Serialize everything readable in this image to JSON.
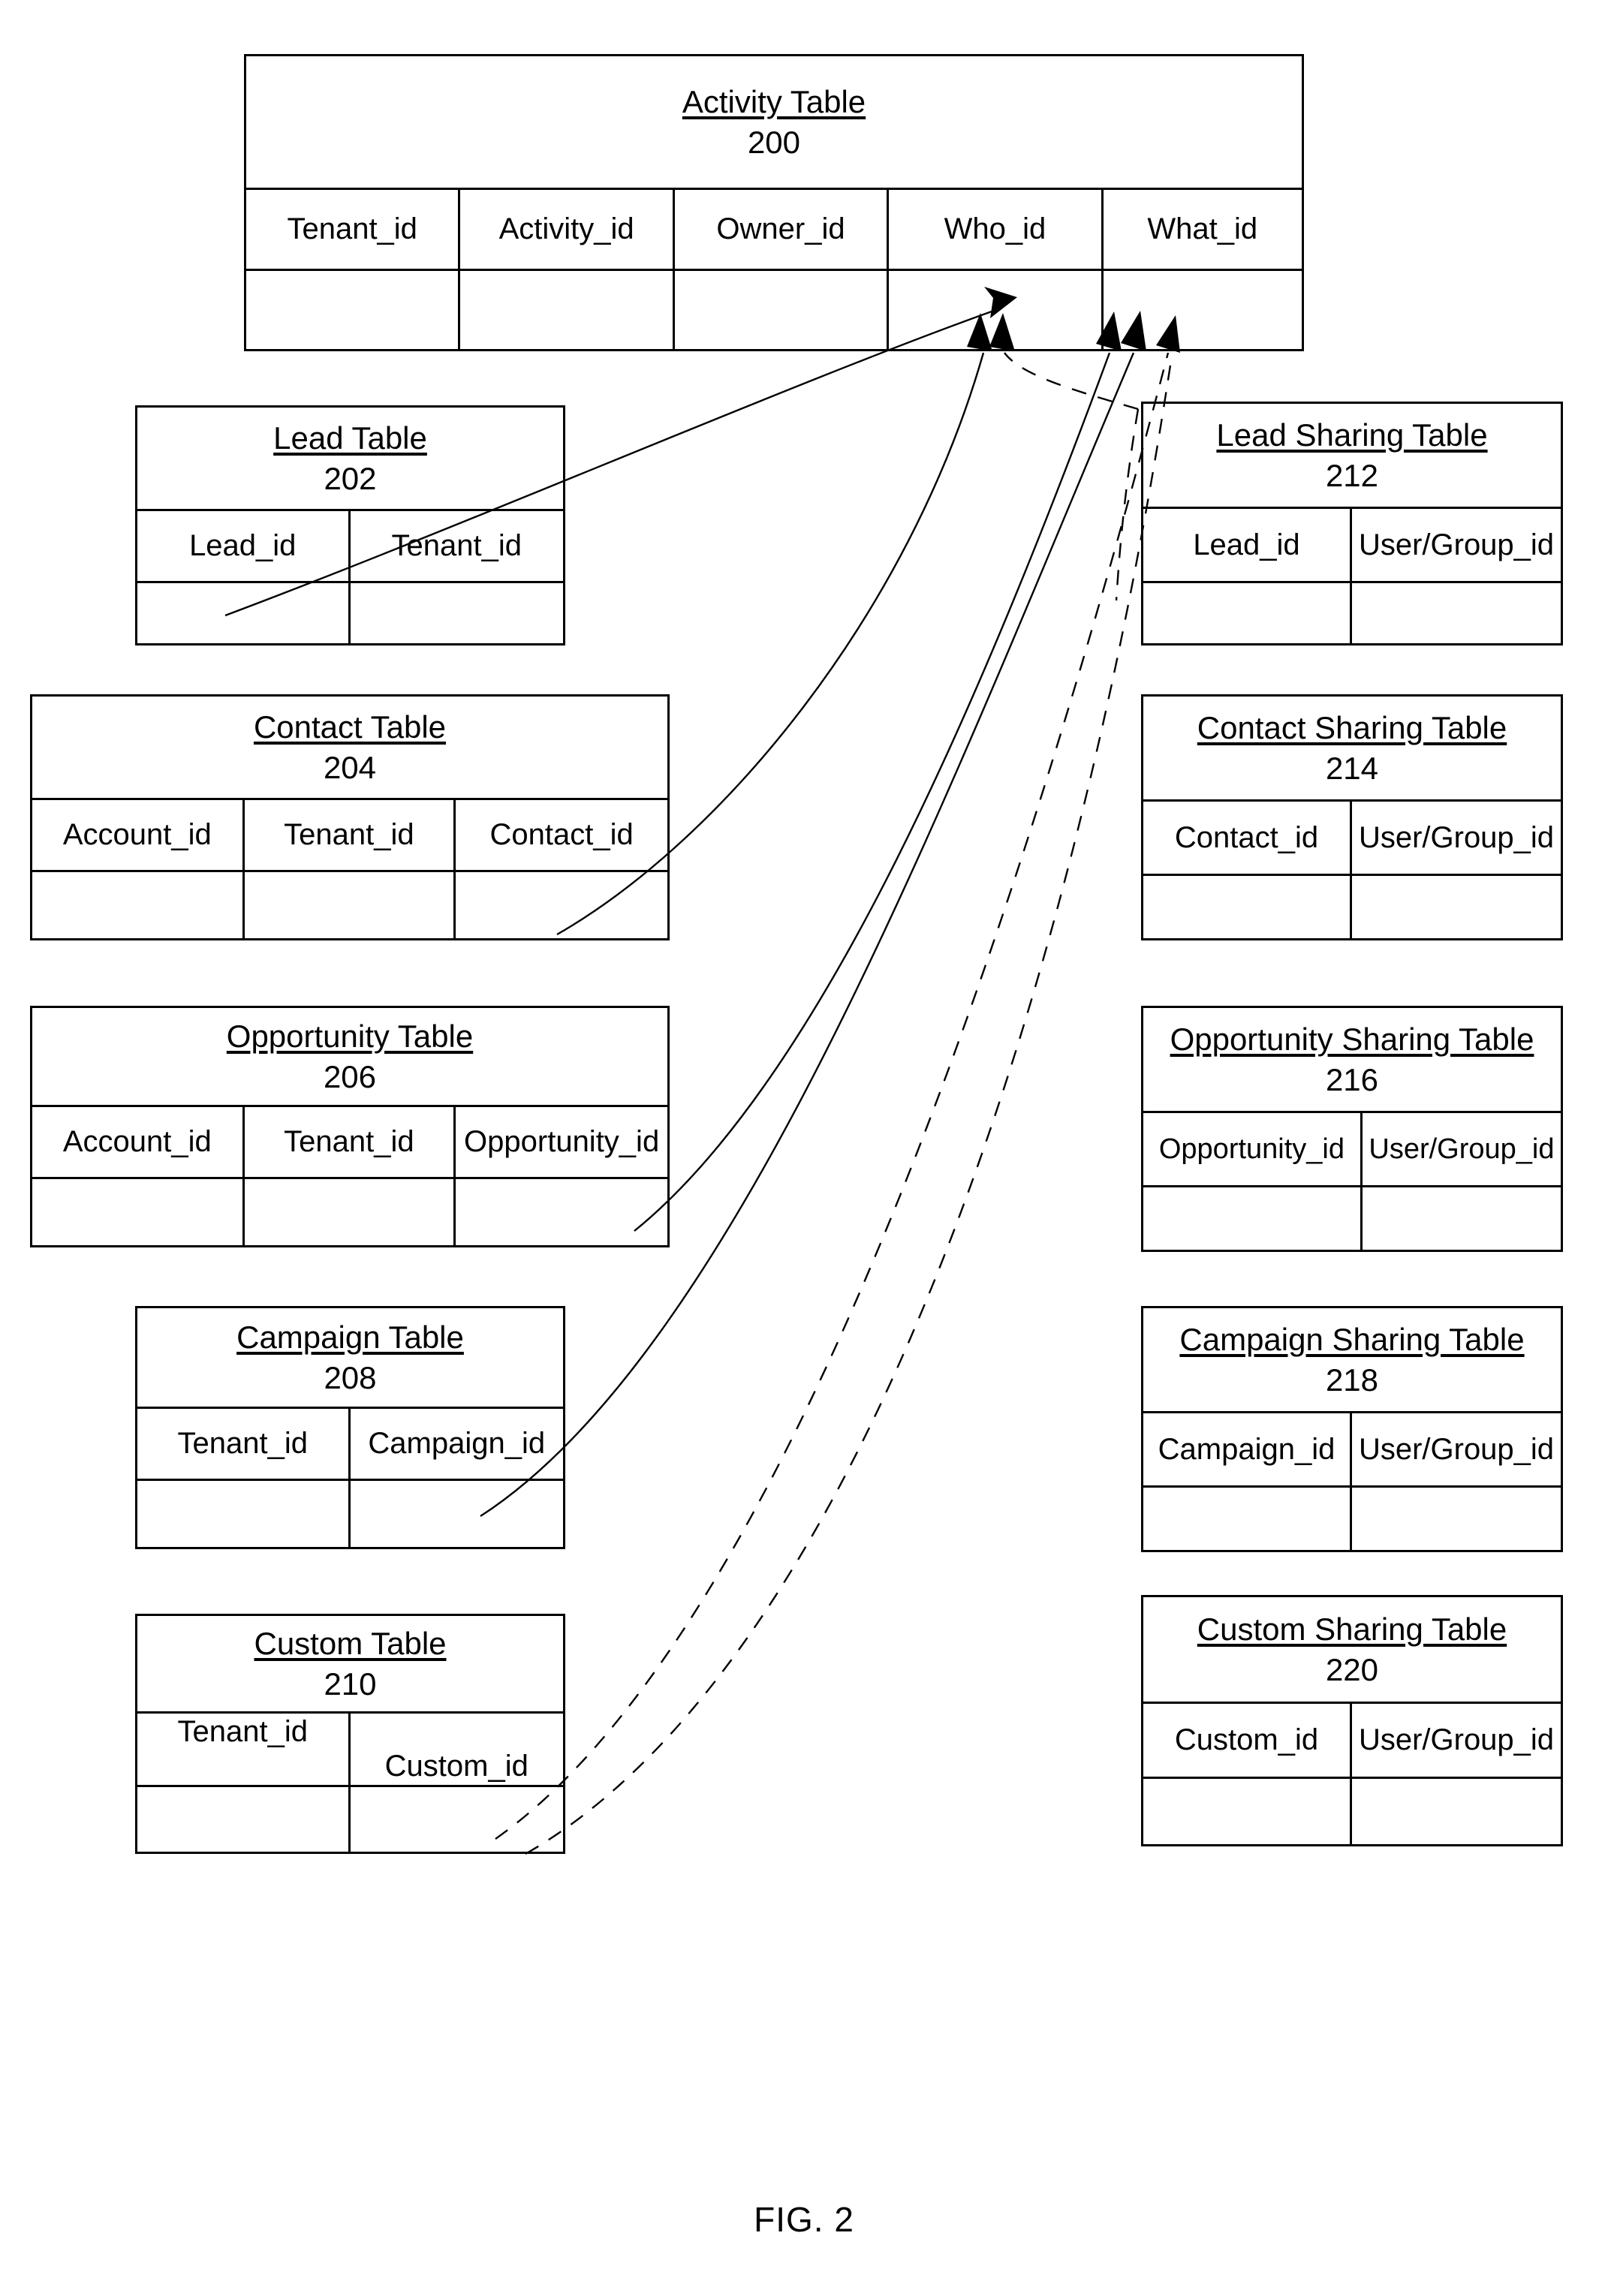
{
  "figure": {
    "caption": "FIG. 2"
  },
  "tables": {
    "activity": {
      "title": "Activity Table",
      "ref": "200",
      "columns": [
        "Tenant_id",
        "Activity_id",
        "Owner_id",
        "Who_id",
        "What_id"
      ]
    },
    "lead": {
      "title": "Lead Table",
      "ref": "202",
      "columns": [
        "Lead_id",
        "Tenant_id"
      ]
    },
    "contact": {
      "title": "Contact Table",
      "ref": "204",
      "columns": [
        "Account_id",
        "Tenant_id",
        "Contact_id"
      ]
    },
    "opportunity": {
      "title": "Opportunity Table",
      "ref": "206",
      "columns": [
        "Account_id",
        "Tenant_id",
        "Opportunity_id"
      ]
    },
    "campaign": {
      "title": "Campaign Table",
      "ref": "208",
      "columns": [
        "Tenant_id",
        "Campaign_id"
      ]
    },
    "custom": {
      "title": "Custom Table",
      "ref": "210",
      "columns": [
        "Tenant_id",
        "Custom_id"
      ]
    },
    "lead_sharing": {
      "title": "Lead Sharing Table",
      "ref": "212",
      "columns": [
        "Lead_id",
        "User/Group_id"
      ]
    },
    "contact_sharing": {
      "title": "Contact Sharing Table",
      "ref": "214",
      "columns": [
        "Contact_id",
        "User/Group_id"
      ]
    },
    "opportunity_sharing": {
      "title": "Opportunity Sharing Table",
      "ref": "216",
      "columns": [
        "Opportunity_id",
        "User/Group_id"
      ]
    },
    "campaign_sharing": {
      "title": "Campaign Sharing Table",
      "ref": "218",
      "columns": [
        "Campaign_id",
        "User/Group_id"
      ]
    },
    "custom_sharing": {
      "title": "Custom Sharing Table",
      "ref": "220",
      "columns": [
        "Custom_id",
        "User/Group_id"
      ]
    }
  },
  "connectors": [
    {
      "from": "lead",
      "to": "activity.Who_id",
      "style": "solid"
    },
    {
      "from": "contact",
      "to": "activity.Who_id",
      "style": "solid"
    },
    {
      "from": "lead_sharing",
      "to": "activity.Who_id",
      "style": "dashed"
    },
    {
      "from": "opportunity",
      "to": "activity.What_id",
      "style": "solid"
    },
    {
      "from": "campaign",
      "to": "activity.What_id",
      "style": "solid"
    },
    {
      "from": "custom",
      "to": "activity.What_id",
      "style": "dashed"
    },
    {
      "from": "custom_sharing",
      "to": "activity.What_id",
      "style": "dashed"
    }
  ],
  "style": {
    "ink": "#000000",
    "paper": "#ffffff"
  }
}
